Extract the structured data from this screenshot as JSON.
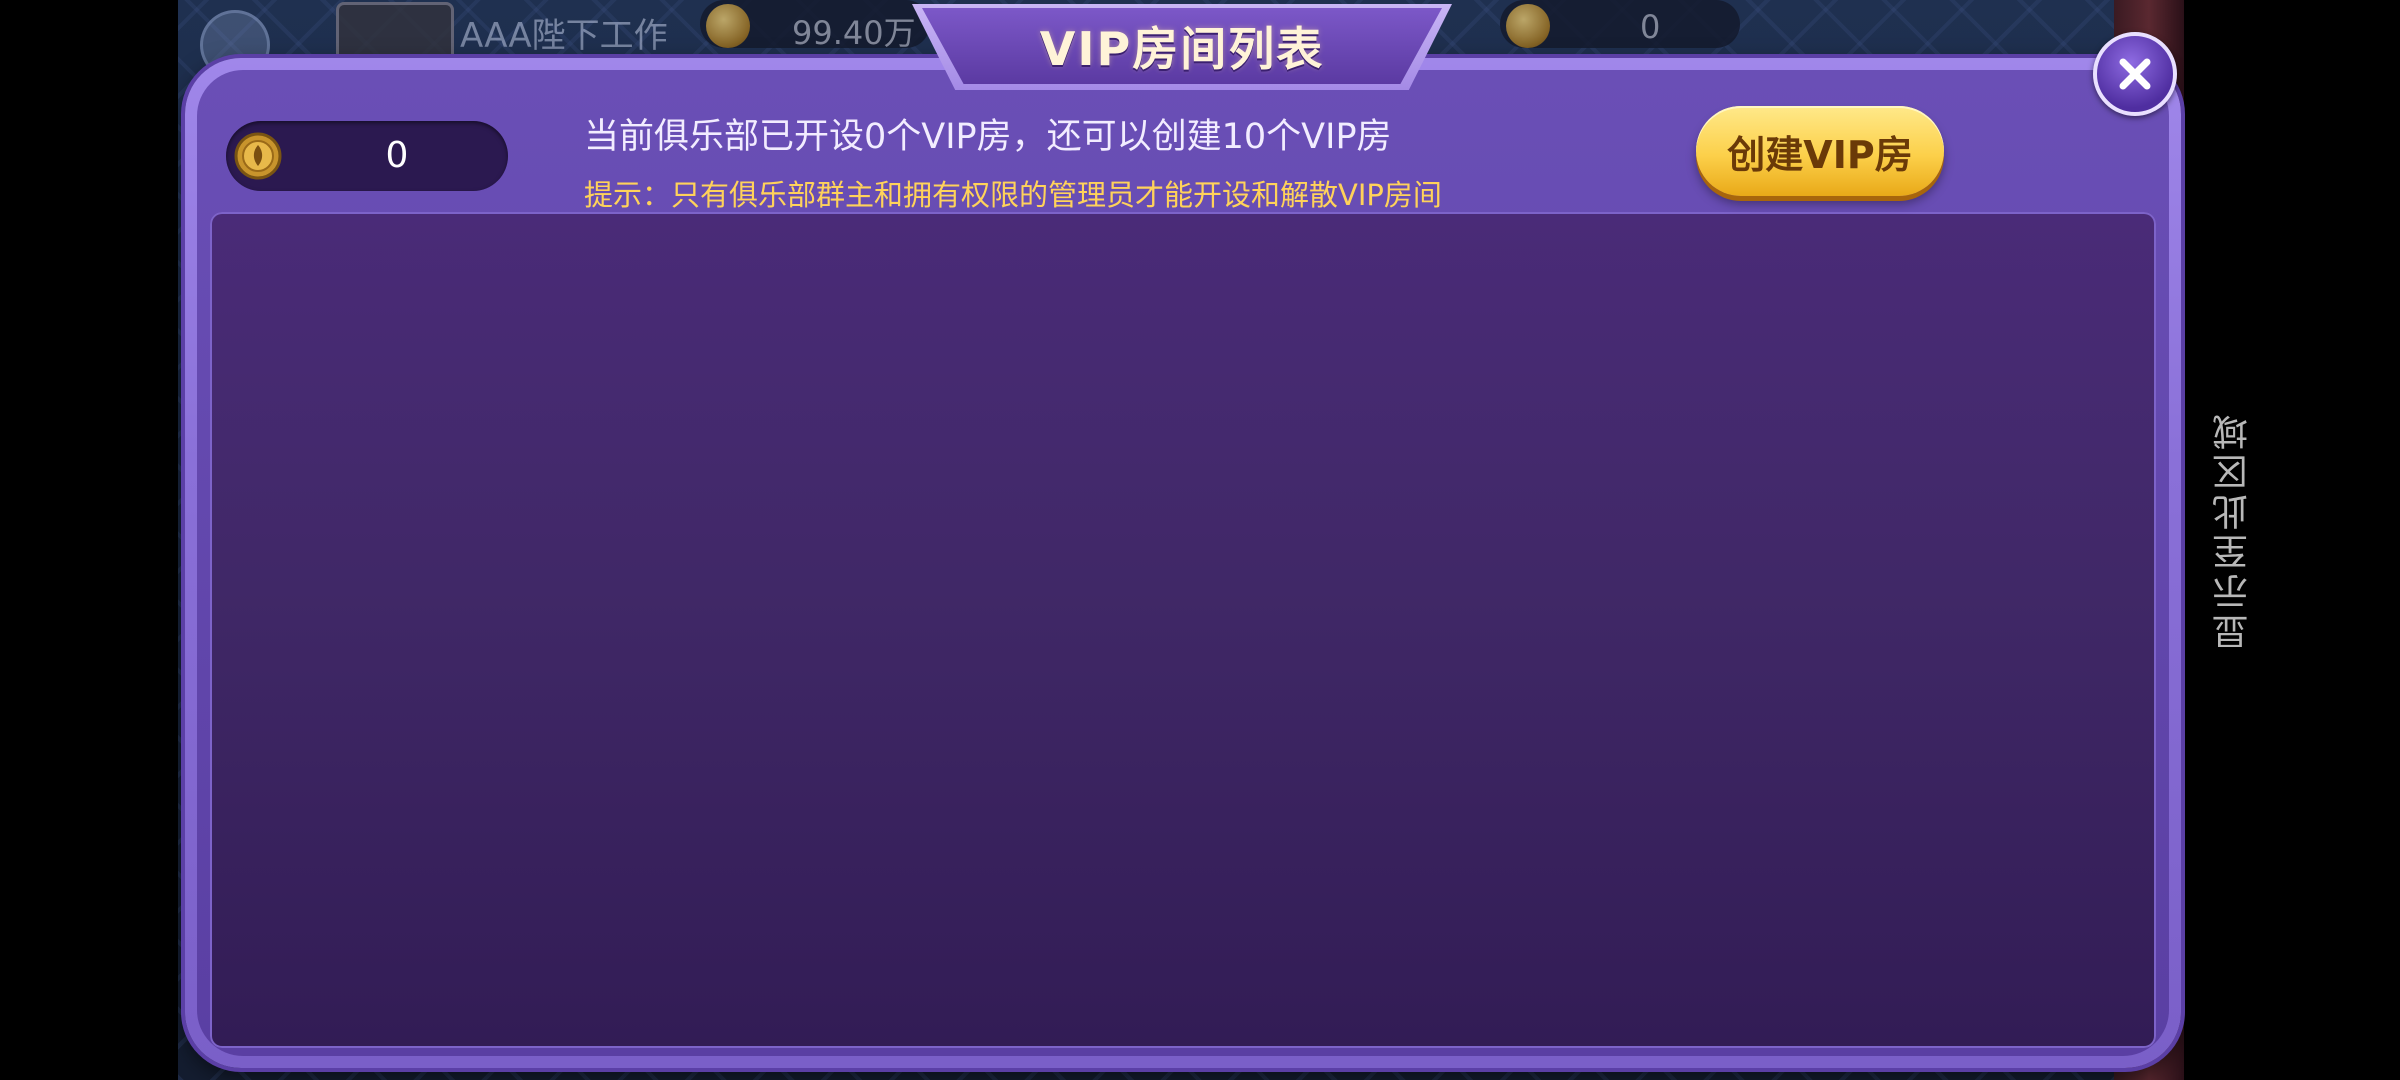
{
  "background": {
    "player_name": "AAA陛下工作",
    "gold_value": "99.40万",
    "diamond_value": "0"
  },
  "dialog": {
    "title": "VIP房间列表",
    "coin_balance": "0",
    "status_text": "当前俱乐部已开设0个VIP房，还可以创建10个VIP房",
    "hint_text": "提示：只有俱乐部群主和拥有权限的管理员才能开设和解散VIP房间",
    "create_button_label": "创建VIP房",
    "rooms": []
  },
  "side_caption": "显示至此区域",
  "icons": {
    "close": "close-icon",
    "coin": "coin-icon"
  },
  "colors": {
    "dialog_border": "#8a70d8",
    "panel": "#402867",
    "hint": "#ffd25a",
    "button_gold": "#fcd04a"
  }
}
